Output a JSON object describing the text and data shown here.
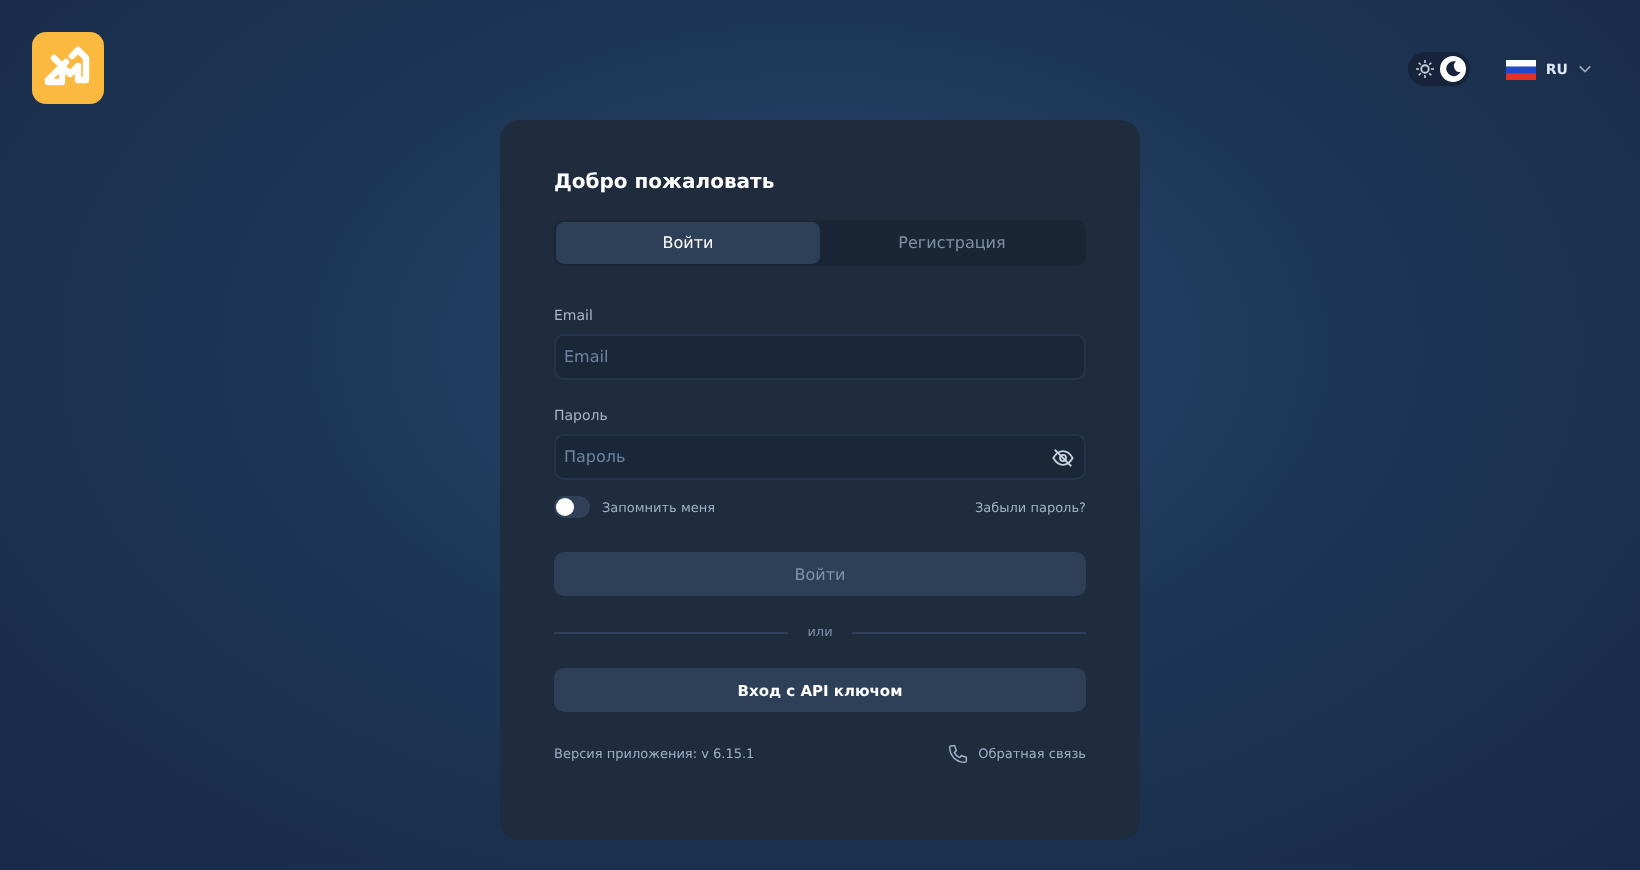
{
  "theme": {
    "dark": true
  },
  "language": {
    "code": "RU"
  },
  "card": {
    "title": "Добро пожаловать",
    "tabs": [
      {
        "label": "Войти",
        "selected": true
      },
      {
        "label": "Регистрация",
        "selected": false
      }
    ],
    "fields": [
      {
        "label": "Email",
        "placeholder": "Email",
        "kind": "text"
      },
      {
        "label": "Пароль",
        "placeholder": "Пароль",
        "kind": "password"
      }
    ],
    "remember": {
      "label": "Запомнить меня",
      "on": false
    },
    "forgot_link": "Забыли пароль?",
    "login_button": {
      "label": "Войти",
      "disabled": true
    },
    "divider_text": "или",
    "api_button": "Вход с API ключом",
    "version": "Версия приложения: v 6.15.1",
    "feedback_link": "Обратная связь"
  }
}
